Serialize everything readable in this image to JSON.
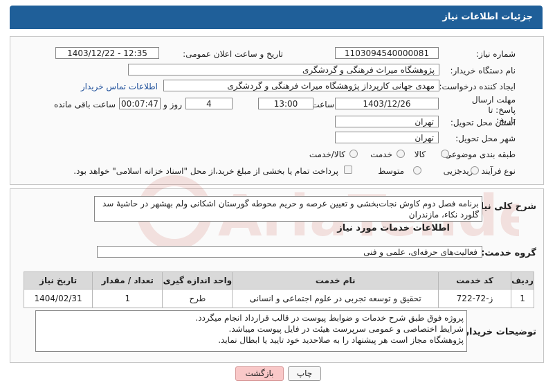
{
  "header": {
    "title": "جزئیات اطلاعات نیاز"
  },
  "labels": {
    "need_number": "شماره نیاز:",
    "announce_datetime": "تاریخ و ساعت اعلان عمومی:",
    "buyer_org": "نام دستگاه خریدار:",
    "requester": "ایجاد کننده درخواست:",
    "buyer_contact": "اطلاعات تماس خریدار",
    "deadline": "مهلت ارسال پاسخ: تا تاریخ:",
    "time": "ساعت",
    "days_and": "روز و",
    "remaining": "ساعت باقی مانده",
    "province": "استان محل تحویل:",
    "city": "شهر محل تحویل:",
    "category": "طبقه بندی موضوعی:",
    "process_type": "نوع فرآیند خرید :",
    "summary": "شرح کلی نیاز:",
    "services_info": "اطلاعات خدمات مورد نیاز",
    "service_group": "گروه خدمت:",
    "buyer_notes": "توضیحات خریدار:"
  },
  "values": {
    "need_number": "1103094540000081",
    "announce_datetime": "1403/12/22 - 12:35",
    "buyer_org": "پژوهشگاه میراث فرهنگی و گردشگری",
    "requester": "مهدی جهانی کارپرداز پژوهشگاه میراث فرهنگی و گردشگری",
    "deadline_date": "1403/12/26",
    "deadline_time": "13:00",
    "days": "4",
    "remaining_time": "00:07:47",
    "province": "تهران",
    "city": "تهران",
    "summary": "برنامه فصل دوم کاوش نجات‌بخشی و تعیین عرصه و حریم محوطه گورستان اشکانی ولم بهشهر در حاشیهٔ سد گلورد نکاء، مازندران",
    "service_group": "فعالیت‌های حرفه‌ای، علمی و فنی",
    "notes_line1": "پروژه فوق طبق شرح خدمات و ضوابط پیوست در قالب قرارداد انجام میگردد.",
    "notes_line2": "شرایط اختصاصی و عمومی سرپرست هیئت در فایل پیوست میباشد.",
    "notes_line3": "پژوهشگاه مجاز است هر پیشنهاد را به صلاحدید خود تایید یا ابطال نماید."
  },
  "category_options": [
    "کالا",
    "خدمت",
    "کالا/خدمت"
  ],
  "process_options": [
    "جزیی",
    "متوسط"
  ],
  "payment_note": "پرداخت تمام یا بخشی از مبلغ خرید،از محل \"اسناد خزانه اسلامی\" خواهد بود.",
  "table": {
    "headers": [
      "ردیف",
      "کد خدمت",
      "نام خدمت",
      "واحد اندازه گیری",
      "تعداد / مقدار",
      "تاریخ نیاز"
    ],
    "rows": [
      [
        "1",
        "ز-72-722",
        "تحقیق و توسعه تجربی در علوم اجتماعی و انسانی",
        "طرح",
        "1",
        "1404/02/31"
      ]
    ]
  },
  "buttons": {
    "print": "چاپ",
    "back": "بازگشت"
  },
  "watermark": {
    "text": "AriaTender.neT"
  },
  "colors": {
    "header_bg": "#1f5f99",
    "back_button": "#f9c8c8",
    "link": "#1e4f9a",
    "watermark": "#c0392b"
  }
}
